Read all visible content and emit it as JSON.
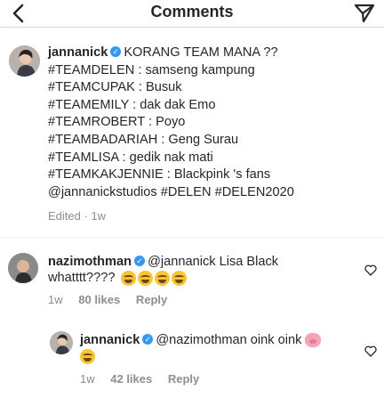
{
  "header": {
    "title": "Comments",
    "back_icon": "chevron-left-icon",
    "send_icon": "paper-plane-icon"
  },
  "caption": {
    "username": "jannanick",
    "text": "KORANG TEAM MANA ??",
    "lines": [
      "#TEAMDELEN : samseng kampung",
      "#TEAMCUPAK : Busuk",
      "#TEAMEMILY : dak dak Emo",
      "#TEAMROBERT : Poyo",
      "#TEAMBADARIAH : Geng Surau",
      "#TEAMLISA : gedik nak mati",
      "#TEAMKAKJENNIE : Blackpink 's fans",
      "@jannanickstudios #DELEN #DELEN2020"
    ],
    "edited_label": "Edited",
    "time": "1w"
  },
  "comments": [
    {
      "username": "nazimothman",
      "text_line1": "@jannanick Lisa Black",
      "text_line2": "whatttt????",
      "emoji": [
        "tears-of-joy-emoji",
        "tears-of-joy-emoji",
        "tears-of-joy-emoji",
        "tears-of-joy-emoji"
      ],
      "time": "1w",
      "likes": "80 likes",
      "reply": "Reply"
    },
    {
      "username": "jannanick",
      "text_line1": "@nazimothman oink oink",
      "emoji": [
        "pig-face-emoji",
        "tears-of-joy-emoji"
      ],
      "time": "1w",
      "likes": "42 likes",
      "reply": "Reply"
    }
  ],
  "colors": {
    "verified": "#3897f0",
    "meta_text": "#8e8e8e",
    "text": "#262626"
  }
}
